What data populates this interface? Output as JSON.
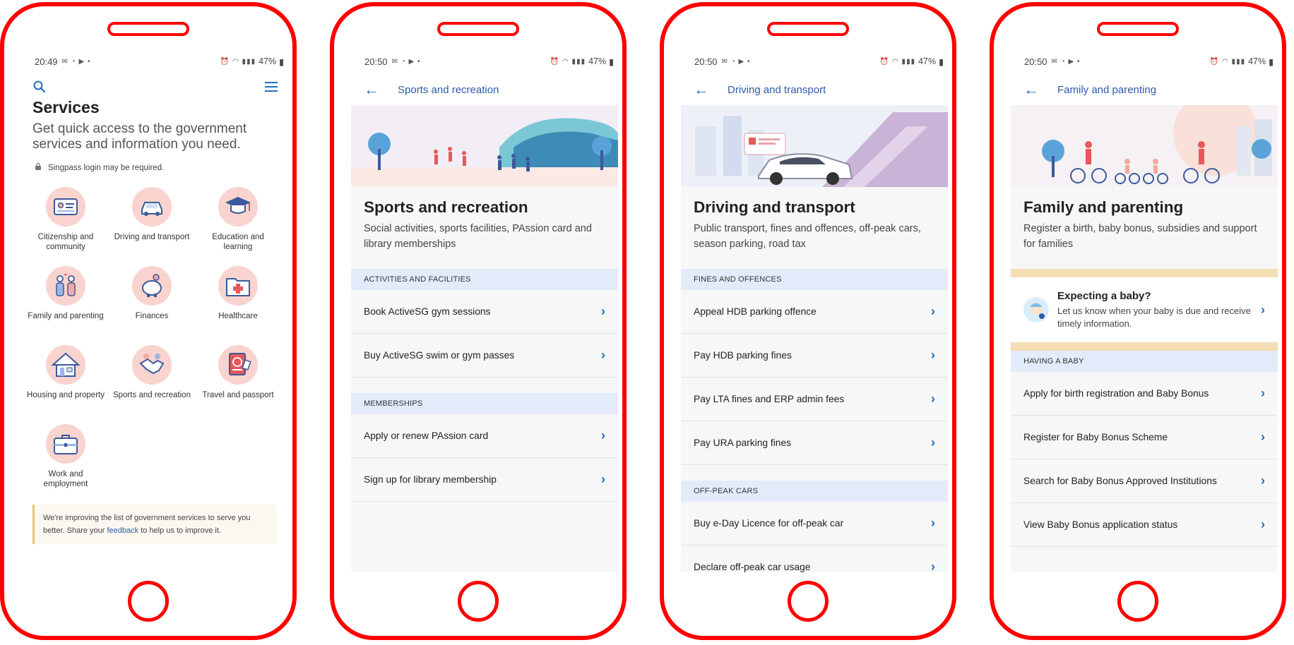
{
  "phones": [
    {
      "status": {
        "time": "20:49",
        "battery": "47%"
      },
      "header": {
        "title": "Services",
        "subtitle": "Get quick access to the government services and information you need.",
        "note": "Singpass login may be required."
      },
      "categories": [
        {
          "label": "Citizenship and community",
          "icon": "id-card-icon"
        },
        {
          "label": "Driving and transport",
          "icon": "car-icon"
        },
        {
          "label": "Education and learning",
          "icon": "graduation-cap-icon"
        },
        {
          "label": "Family and parenting",
          "icon": "family-icon"
        },
        {
          "label": "Finances",
          "icon": "piggy-bank-icon"
        },
        {
          "label": "Healthcare",
          "icon": "medical-folder-icon"
        },
        {
          "label": "Housing and property",
          "icon": "house-icon"
        },
        {
          "label": "Sports and recreation",
          "icon": "handshake-icon"
        },
        {
          "label": "Travel and passport",
          "icon": "passport-icon"
        },
        {
          "label": "Work and employment",
          "icon": "briefcase-icon"
        }
      ],
      "banner": {
        "text_before": "We're improving the list of government services to serve you better. Share your ",
        "link": "feedback",
        "text_after": " to help us to improve it."
      }
    },
    {
      "status": {
        "time": "20:50",
        "battery": "47%"
      },
      "nav_title": "Sports and recreation",
      "title": "Sports and recreation",
      "description": "Social activities, sports facilities, PAssion card and library memberships",
      "sections": [
        {
          "header": "ACTIVITIES AND FACILITIES",
          "items": [
            "Book ActiveSG gym sessions",
            "Buy ActiveSG swim or gym passes"
          ]
        },
        {
          "header": "MEMBERSHIPS",
          "items": [
            "Apply or renew PAssion card",
            "Sign up for library membership"
          ]
        }
      ]
    },
    {
      "status": {
        "time": "20:50",
        "battery": "47%"
      },
      "nav_title": "Driving and transport",
      "title": "Driving and transport",
      "description": "Public transport, fines and offences, off-peak cars, season parking, road tax",
      "sections": [
        {
          "header": "FINES AND OFFENCES",
          "items": [
            "Appeal HDB parking offence",
            "Pay HDB parking fines",
            "Pay LTA fines and ERP admin fees",
            "Pay URA parking fines"
          ]
        },
        {
          "header": "OFF-PEAK CARS",
          "items": [
            "Buy e-Day Licence for off-peak car",
            "Declare off-peak car usage"
          ]
        }
      ]
    },
    {
      "status": {
        "time": "20:50",
        "battery": "47%"
      },
      "nav_title": "Family and parenting",
      "title": "Family and parenting",
      "description": "Register a birth, baby bonus, subsidies and support for families",
      "promo": {
        "title": "Expecting a baby?",
        "text": "Let us know when your baby is due and receive timely information."
      },
      "sections": [
        {
          "header": "HAVING A BABY",
          "items": [
            "Apply for birth registration and Baby Bonus",
            "Register for Baby Bonus Scheme",
            "Search for Baby Bonus Approved Institutions",
            "View Baby Bonus application status"
          ]
        }
      ]
    }
  ]
}
